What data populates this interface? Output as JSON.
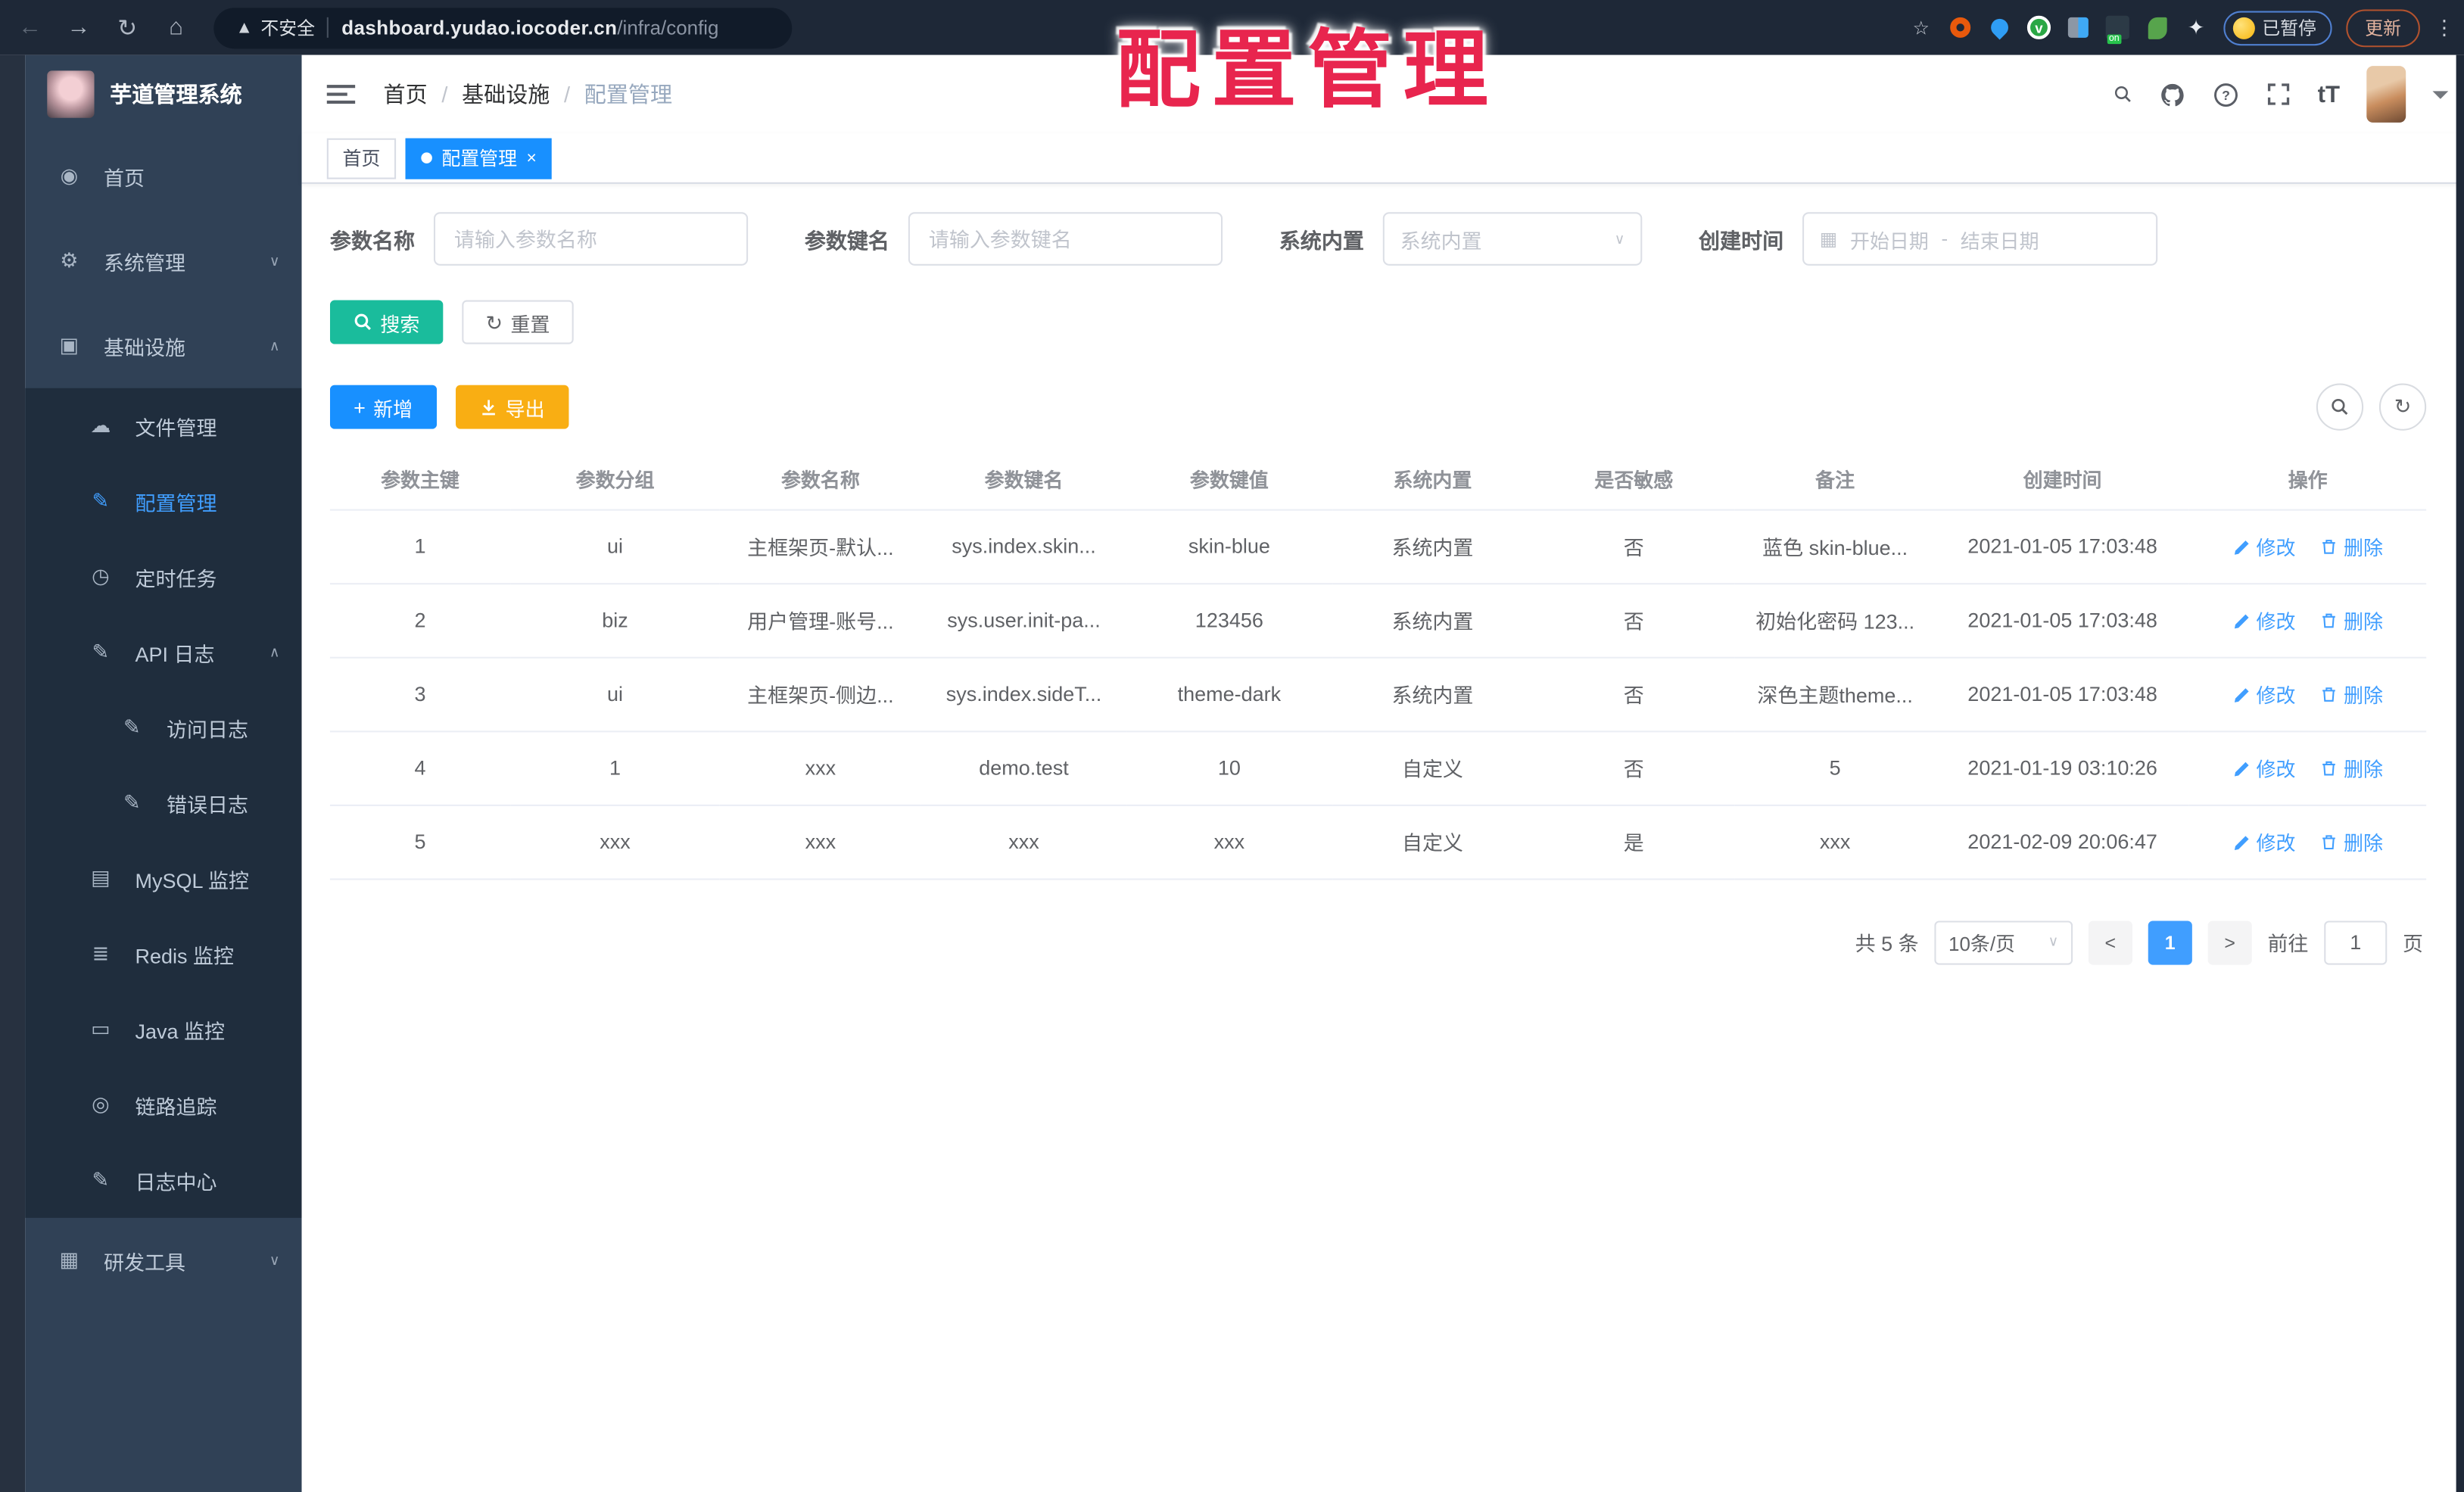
{
  "watermark": {
    "text": "配置管理"
  },
  "browser": {
    "security_label": "不安全",
    "url_host": "dashboard.yudao.iocoder.cn",
    "url_path": "/infra/config",
    "paused_label": "已暂停",
    "update_label": "更新",
    "icons": {
      "back": "←",
      "forward": "→",
      "reload": "↻",
      "home": "⌂",
      "warning": "▲",
      "star": "☆",
      "puzzle": "✦",
      "kebab": "⋮",
      "green_v": "v"
    }
  },
  "sidebar": {
    "logo_title": "芋道管理系统",
    "items": [
      {
        "label": "首页",
        "glyph": "◉",
        "chevron_glyph": ""
      },
      {
        "label": "系统管理",
        "glyph": "⚙",
        "chevron_glyph": "∨"
      },
      {
        "label": "基础设施",
        "glyph": "▣",
        "chevron_glyph": "∧"
      },
      {
        "label": "文件管理",
        "glyph": "☁",
        "chevron_glyph": ""
      },
      {
        "label": "配置管理",
        "glyph": "✎",
        "chevron_glyph": ""
      },
      {
        "label": "定时任务",
        "glyph": "◷",
        "chevron_glyph": ""
      },
      {
        "label": "API 日志",
        "glyph": "✎",
        "chevron_glyph": "∧"
      },
      {
        "label": "访问日志",
        "glyph": "✎",
        "chevron_glyph": ""
      },
      {
        "label": "错误日志",
        "glyph": "✎",
        "chevron_glyph": ""
      },
      {
        "label": "MySQL 监控",
        "glyph": "▤",
        "chevron_glyph": ""
      },
      {
        "label": "Redis 监控",
        "glyph": "≣",
        "chevron_glyph": ""
      },
      {
        "label": "Java 监控",
        "glyph": "▭",
        "chevron_glyph": ""
      },
      {
        "label": "链路追踪",
        "glyph": "◎",
        "chevron_glyph": ""
      },
      {
        "label": "日志中心",
        "glyph": "✎",
        "chevron_glyph": ""
      },
      {
        "label": "研发工具",
        "glyph": "▦",
        "chevron_glyph": "∨"
      }
    ]
  },
  "header": {
    "breadcrumb": [
      "首页",
      "基础设施",
      "配置管理"
    ],
    "breadcrumb_separator": "/",
    "font_icon": "tT"
  },
  "tags": {
    "home_label": "首页",
    "active_label": "配置管理",
    "close_glyph": "×"
  },
  "filters": {
    "name": {
      "label": "参数名称",
      "placeholder": "请输入参数名称"
    },
    "key": {
      "label": "参数键名",
      "placeholder": "请输入参数键名"
    },
    "builtin": {
      "label": "系统内置",
      "placeholder": "系统内置",
      "chevron": "∨"
    },
    "created": {
      "label": "创建时间",
      "start_placeholder": "开始日期",
      "separator": "-",
      "end_placeholder": "结束日期",
      "calendar_glyph": "▦"
    }
  },
  "toolbar": {
    "search_label": "搜索",
    "reset_label": "重置",
    "add_label": "新增",
    "export_label": "导出",
    "reset_glyph": "↻",
    "add_glyph": "+",
    "refresh_glyph": "↻"
  },
  "table": {
    "headers": [
      "参数主键",
      "参数分组",
      "参数名称",
      "参数键名",
      "参数键值",
      "系统内置",
      "是否敏感",
      "备注",
      "创建时间",
      "操作"
    ],
    "ops": {
      "edit": "修改",
      "delete": "删除"
    },
    "rows": [
      {
        "cells": [
          "1",
          "ui",
          "主框架页-默认...",
          "sys.index.skin...",
          "skin-blue",
          "系统内置",
          "否",
          "蓝色 skin-blue...",
          "2021-01-05 17:03:48"
        ]
      },
      {
        "cells": [
          "2",
          "biz",
          "用户管理-账号...",
          "sys.user.init-pa...",
          "123456",
          "系统内置",
          "否",
          "初始化密码 123...",
          "2021-01-05 17:03:48"
        ]
      },
      {
        "cells": [
          "3",
          "ui",
          "主框架页-侧边...",
          "sys.index.sideT...",
          "theme-dark",
          "系统内置",
          "否",
          "深色主题theme...",
          "2021-01-05 17:03:48"
        ]
      },
      {
        "cells": [
          "4",
          "1",
          "xxx",
          "demo.test",
          "10",
          "自定义",
          "否",
          "5",
          "2021-01-19 03:10:26"
        ]
      },
      {
        "cells": [
          "5",
          "xxx",
          "xxx",
          "xxx",
          "xxx",
          "自定义",
          "是",
          "xxx",
          "2021-02-09 20:06:47"
        ]
      }
    ]
  },
  "pagination": {
    "total_text": "共 5 条",
    "page_size": "10条/页",
    "chevron": "∨",
    "prev_glyph": "<",
    "next_glyph": ">",
    "active_page": "1",
    "goto_label": "前往",
    "goto_value": "1",
    "page_unit": "页"
  }
}
